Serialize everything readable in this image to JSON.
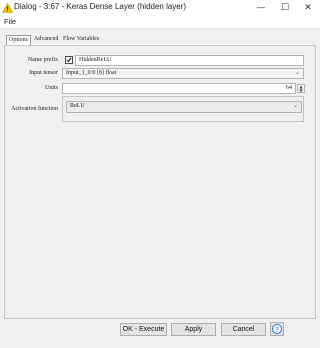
{
  "window": {
    "title": "Dialog - 3:67 - Keras Dense Layer (hidden layer)",
    "minimize_glyph": "—",
    "maximize_glyph": "☐",
    "close_glyph": "✕"
  },
  "menu": {
    "file": "File"
  },
  "tabs": [
    {
      "label": "Options",
      "active": true
    },
    {
      "label": "Advanced",
      "active": false
    },
    {
      "label": "Flow Variables",
      "active": false
    }
  ],
  "form": {
    "name_prefix_label": "Name prefix",
    "name_prefix_checked": true,
    "name_prefix_value": "HiddenReLU",
    "input_tensor_label": "Input tensor",
    "input_tensor_value": "Input_1_0:0 [8] float",
    "units_label": "Units",
    "units_value": "64",
    "activation_label": "Activation function",
    "activation_value": "ReLU"
  },
  "buttons": {
    "ok_execute": "OK - Execute",
    "apply": "Apply",
    "cancel": "Cancel"
  },
  "colors": {
    "warning": "#f2c200",
    "help": "#2f7fd6"
  },
  "icons": [
    "warning-icon",
    "checkmark-icon",
    "help-icon"
  ]
}
